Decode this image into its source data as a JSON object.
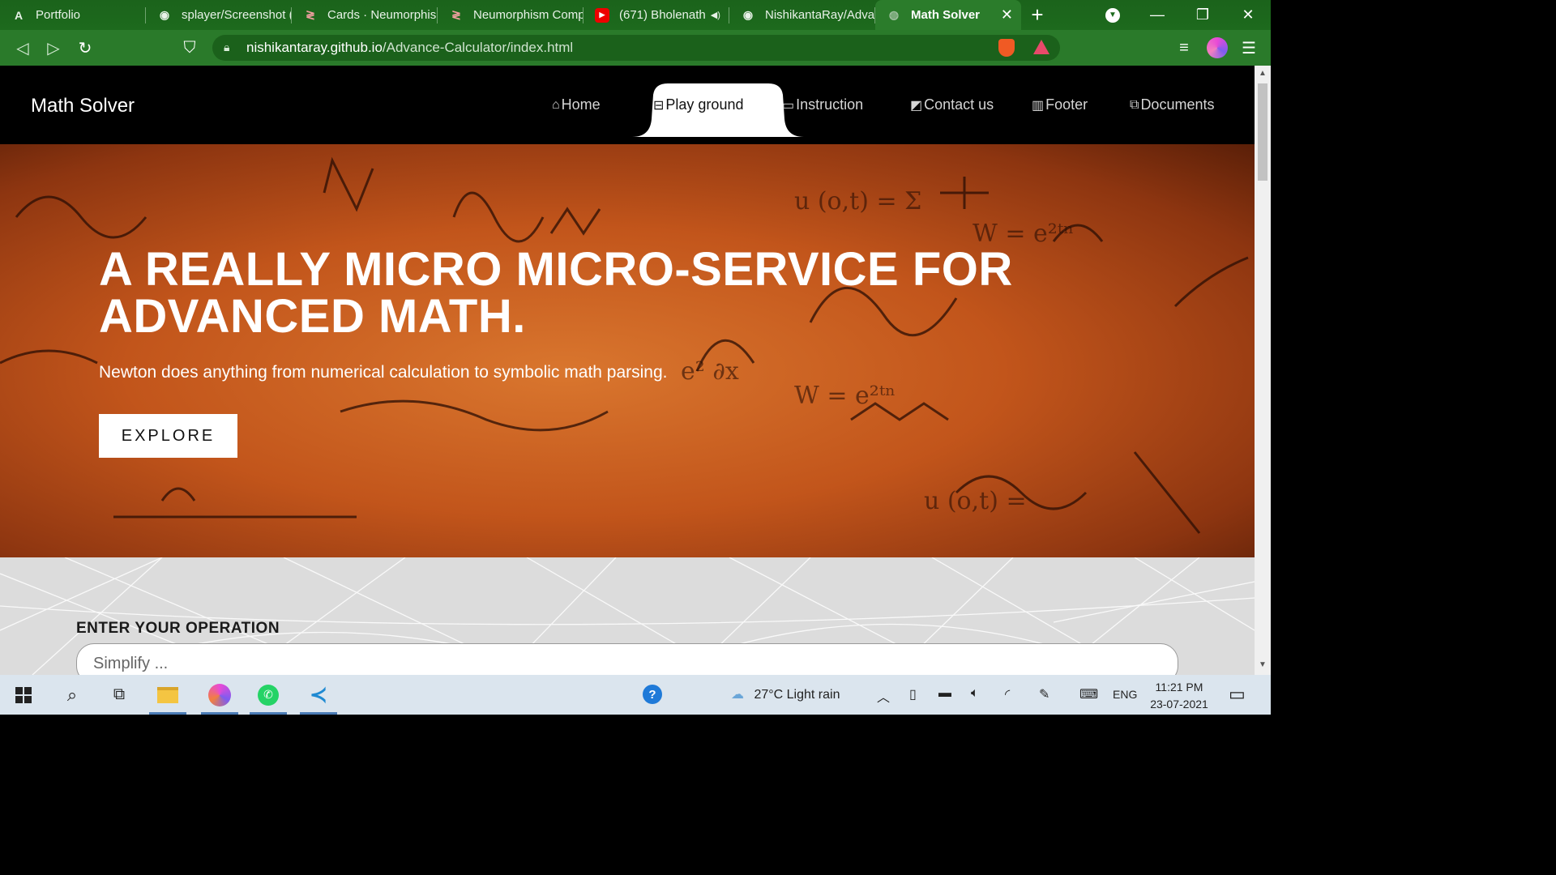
{
  "browser": {
    "tabs": [
      {
        "label": "Portfolio",
        "icon": "portfolio-a-icon",
        "glyph": "A"
      },
      {
        "label": "splayer/Screenshot (",
        "icon": "github-icon",
        "glyph": "◉"
      },
      {
        "label": "Cards · Neumorphisr",
        "icon": "codepen-icon",
        "glyph": "≷"
      },
      {
        "label": "Neumorphism Comp",
        "icon": "codepen-icon",
        "glyph": "≷"
      },
      {
        "label": "(671) Bholenath",
        "icon": "youtube-icon",
        "glyph": "▶"
      },
      {
        "label": "NishikantaRay/Advar",
        "icon": "github-icon",
        "glyph": "◉"
      },
      {
        "label": "Math Solver",
        "icon": "globe-icon",
        "glyph": "◍",
        "active": true
      }
    ],
    "address_host": "nishikantaray.github.io",
    "address_path": "/Advance-Calculator/index.html"
  },
  "site": {
    "brand": "Math Solver",
    "nav": [
      {
        "label": "Home",
        "icon": "home-icon",
        "glyph": "⌂"
      },
      {
        "label": "Play ground",
        "icon": "playground-icon",
        "glyph": "⊟",
        "active": true
      },
      {
        "label": "Instruction",
        "icon": "instruction-icon",
        "glyph": "▭"
      },
      {
        "label": "Contact us",
        "icon": "contact-icon",
        "glyph": "◩"
      },
      {
        "label": "Footer",
        "icon": "footer-chart-icon",
        "glyph": "▥"
      },
      {
        "label": "Documents",
        "icon": "documents-icon",
        "glyph": "⧉"
      }
    ],
    "hero": {
      "title": "A REALLY MICRO MICRO-SERVICE FOR ADVANCED MATH.",
      "subtitle": "Newton does anything from numerical calculation to symbolic math parsing.",
      "button": "EXPLORE"
    },
    "operation": {
      "heading": "ENTER YOUR OPERATION",
      "placeholder": "Simplify ..."
    }
  },
  "taskbar": {
    "weather": "27°C  Light rain",
    "language": "ENG",
    "time": "11:21 PM",
    "date": "23-07-2021"
  }
}
